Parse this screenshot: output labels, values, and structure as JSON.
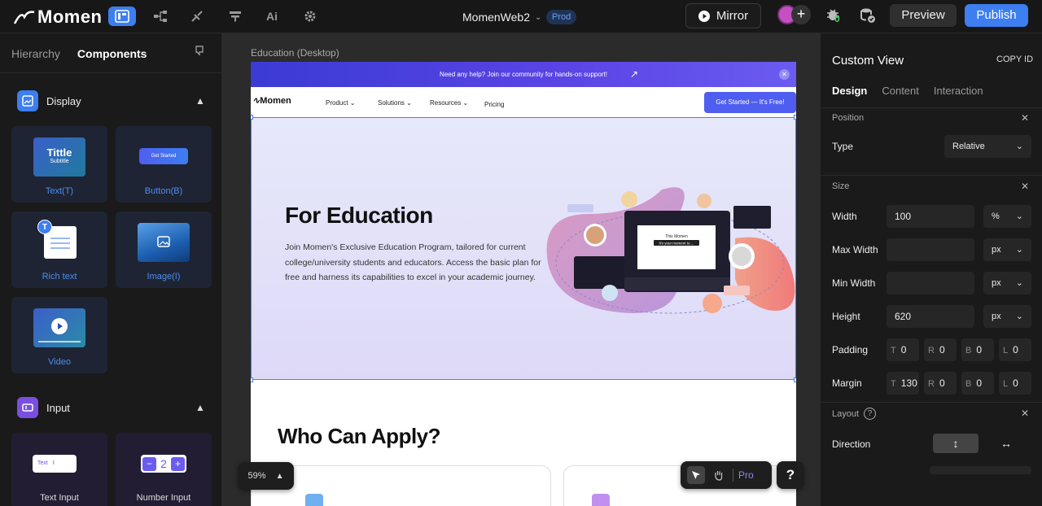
{
  "app": {
    "logo": "Momen",
    "project_name": "MomenWeb2",
    "env_badge": "Prod",
    "mirror_label": "Mirror",
    "preview_label": "Preview",
    "publish_label": "Publish",
    "bug_count": "0",
    "toolbar_icons": [
      "pages-icon",
      "data-model-icon",
      "actions-icon",
      "api-icon",
      "ai-icon",
      "settings-icon"
    ]
  },
  "left_panel": {
    "tabs": [
      "Hierarchy",
      "Components"
    ],
    "display_section": {
      "title": "Display",
      "items": [
        {
          "label": "Text(T)",
          "thumb_title": "Tittle",
          "thumb_subtitle": "Subtitle"
        },
        {
          "label": "Button(B)",
          "thumb_text": "Get Started"
        },
        {
          "label": "Rich text",
          "thumb_badge": "T"
        },
        {
          "label": "Image(I)"
        },
        {
          "label": "Video"
        }
      ]
    },
    "input_section": {
      "title": "Input",
      "items": [
        {
          "label": "Text Input",
          "thumb_text": "Text"
        },
        {
          "label": "Number Input",
          "thumb_value": "2"
        }
      ]
    }
  },
  "canvas": {
    "frame_label": "Education (Desktop)",
    "zoom": "59%",
    "tool_pro": "Pro",
    "help": "?",
    "page": {
      "banner_text": "Need any help? Join our community for hands-on support!",
      "banner_arrow": "↗",
      "banner_close": "✕",
      "nav_logo": "Momen",
      "nav_items": [
        "Product",
        "Solutions",
        "Resources",
        "Pricing"
      ],
      "nav_cta": "Get Started — It's Free!",
      "hero_title": "For Education",
      "hero_desc": "Join Momen's Exclusive Education Program, tailored for current college/university students and educators. Access the basic plan for free and harness its capabilities to excel in your academic journey.",
      "illustration": {
        "mock_title": "This Momen",
        "mock_subtitle": "It's your moment to ..."
      },
      "section_title": "Who Can Apply?"
    }
  },
  "right_panel": {
    "title": "Custom View",
    "copy_id": "COPY ID",
    "tabs": [
      "Design",
      "Content",
      "Interaction"
    ],
    "position": {
      "section": "Position",
      "type_label": "Type",
      "type_value": "Relative"
    },
    "size": {
      "section": "Size",
      "width_label": "Width",
      "width_value": "100",
      "width_unit": "%",
      "max_width_label": "Max Width",
      "max_width_value": "",
      "max_width_unit": "px",
      "min_width_label": "Min Width",
      "min_width_value": "",
      "min_width_unit": "px",
      "height_label": "Height",
      "height_value": "620",
      "height_unit": "px",
      "padding_label": "Padding",
      "padding": {
        "t": "0",
        "r": "0",
        "b": "0",
        "l": "0"
      },
      "margin_label": "Margin",
      "margin": {
        "t": "130",
        "r": "0",
        "b": "0",
        "l": "0"
      }
    },
    "layout": {
      "section": "Layout",
      "help": "?",
      "direction_label": "Direction"
    }
  },
  "colors": {
    "accent": "#3d7ef0",
    "panel_bg": "#1a1a1a",
    "canvas_bg": "#2b2b2b",
    "banner": "#4f45e0",
    "cta": "#4f5ef0"
  }
}
